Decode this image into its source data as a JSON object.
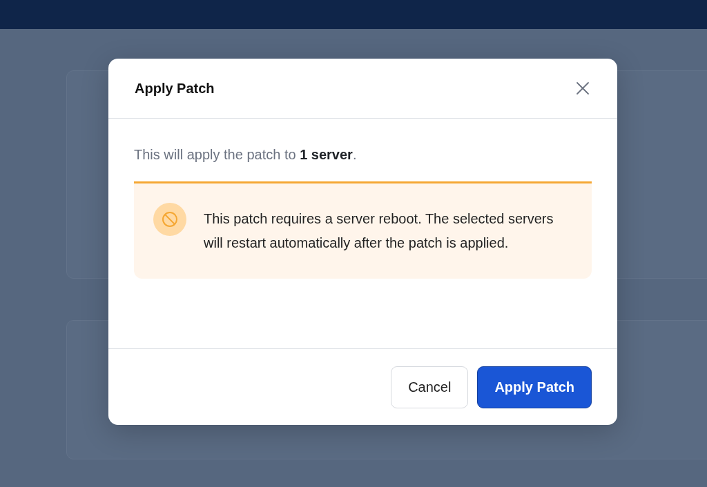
{
  "dialog": {
    "title": "Apply Patch",
    "summary": "This will apply the patch to **1 server**.",
    "alert": {
      "kind": "warning",
      "message": "This patch requires a server reboot. The selected servers will restart automatically after the patch is applied."
    },
    "buttons": [
      {
        "label": "Cancel",
        "kind": "secondary"
      },
      {
        "label": "Apply Patch",
        "kind": "primary"
      }
    ]
  }
}
